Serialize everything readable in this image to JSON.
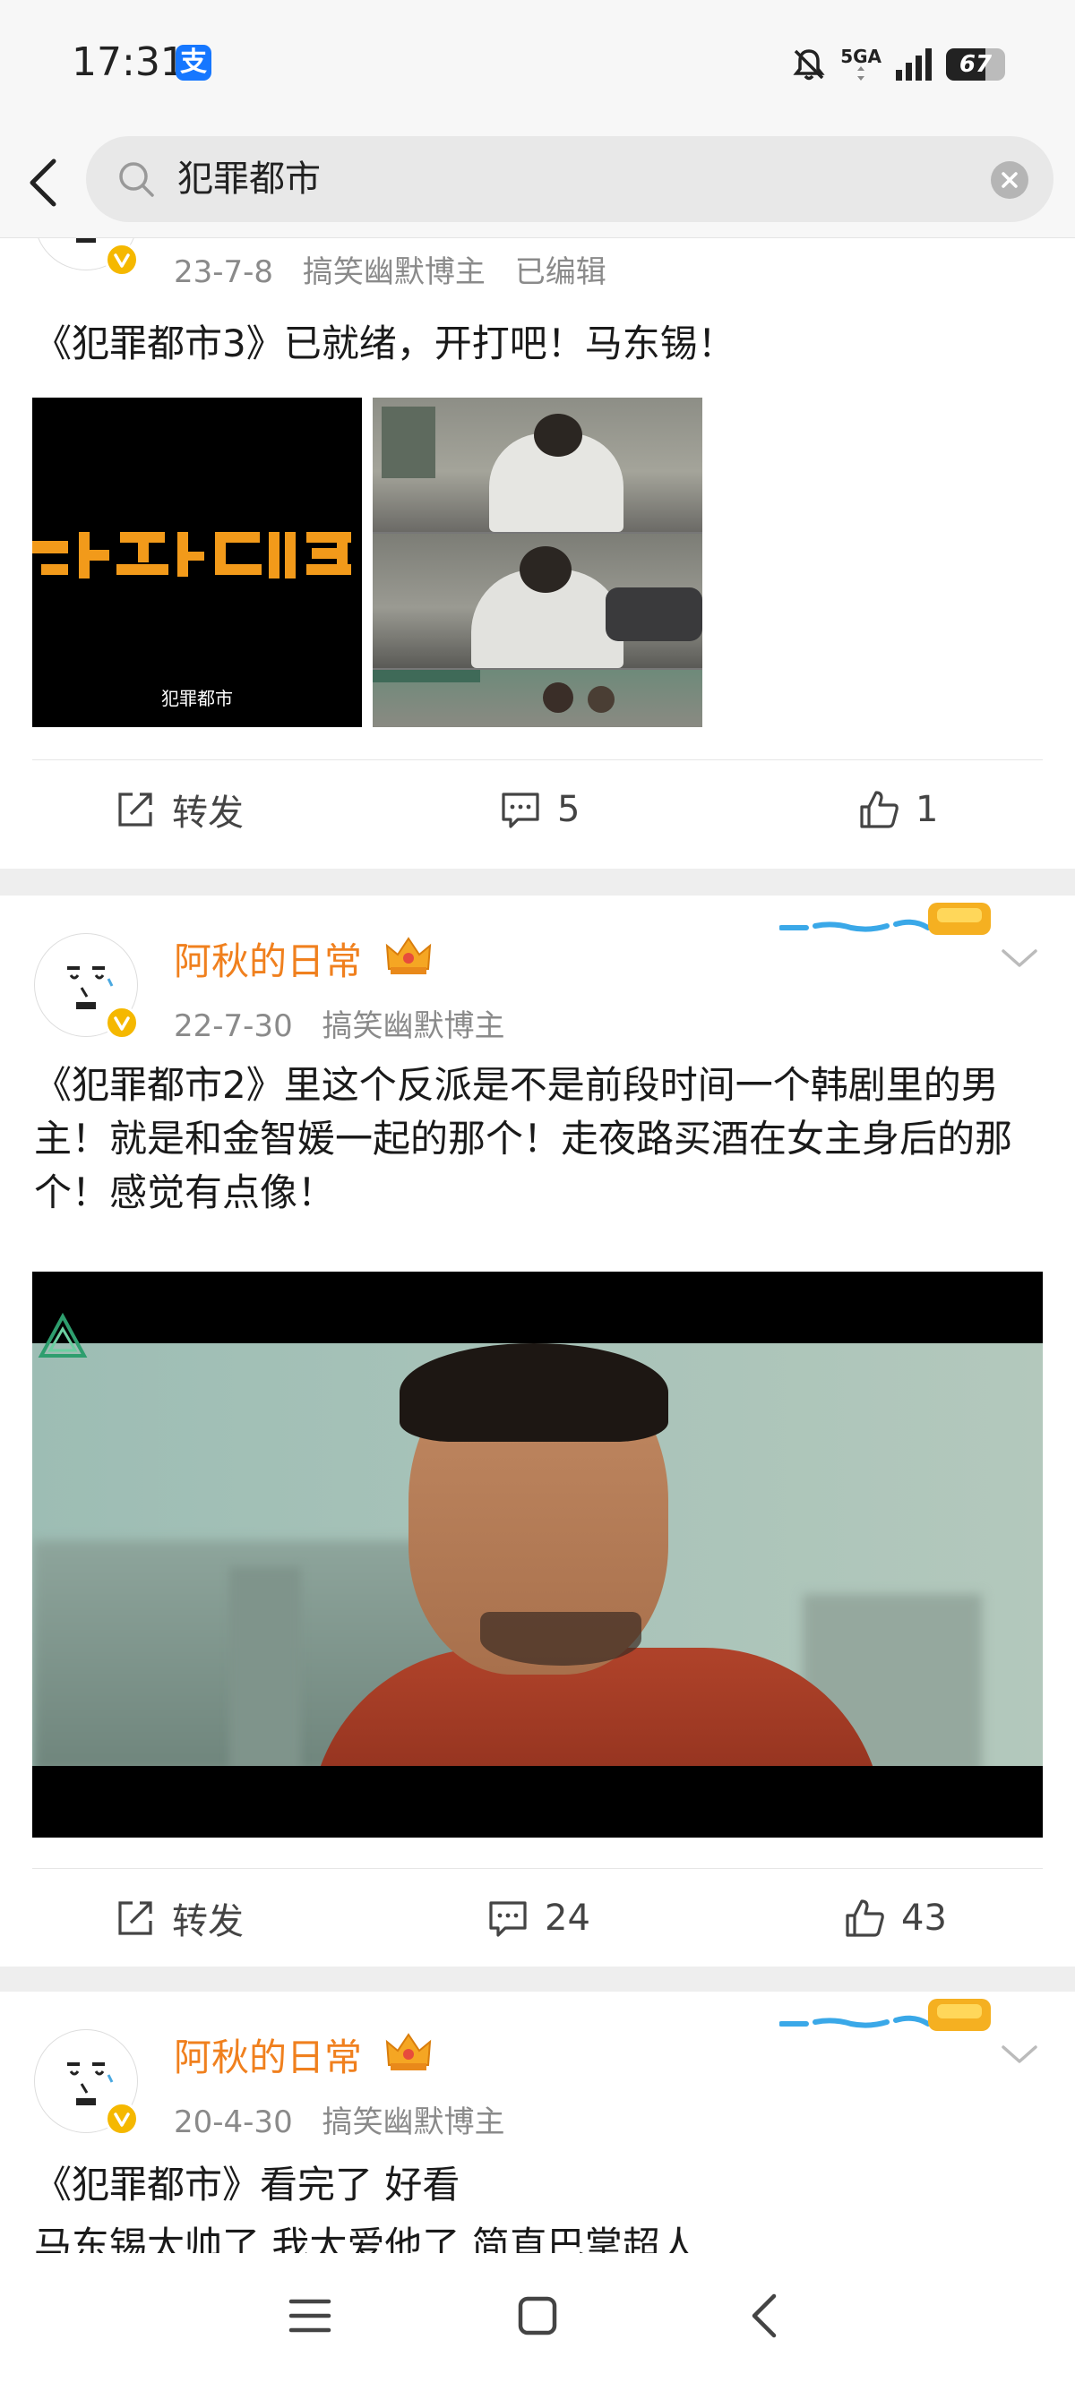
{
  "status_bar": {
    "time": "17:31",
    "alipay_glyph": "支",
    "network": "5GA",
    "battery": "67",
    "battery_level": 0.67,
    "icons": [
      "alipay-icon",
      "bell-mute-icon",
      "signal-icon",
      "battery-icon"
    ]
  },
  "search": {
    "query": "犯罪都市",
    "back_icon": "chevron-left-icon",
    "search_icon": "search-icon",
    "clear_icon": "clear-icon"
  },
  "posts": [
    {
      "date": "23-7-8",
      "tag": "搞笑幽默博主",
      "edited": "已编辑",
      "text": "《犯罪都市3》已就绪，开打吧！马东锡！",
      "image_caption": "犯罪都市",
      "actions": {
        "repost": "转发",
        "comments": "5",
        "likes": "1"
      }
    },
    {
      "username": "阿秋的日常",
      "date": "22-7-30",
      "tag": "搞笑幽默博主",
      "text": "《犯罪都市2》里这个反派是不是前段时间一个韩剧里的男主！就是和金智媛一起的那个！走夜路买酒在女主身后的那个！感觉有点像！",
      "actions": {
        "repost": "转发",
        "comments": "24",
        "likes": "43"
      }
    },
    {
      "username": "阿秋的日常",
      "date": "20-4-30",
      "tag": "搞笑幽默博主",
      "text_line1": "《犯罪都市》看完了 好看",
      "text_line2": "马东锡太帅了 我太爱他了 简直巴掌超人"
    }
  ],
  "colors": {
    "username": "#f0801e",
    "meta": "#8a8a8a",
    "vip_badge": "#f5b800",
    "poster_title": "#f29a1a"
  },
  "nav": [
    "menu-icon",
    "home-icon",
    "back-icon"
  ]
}
